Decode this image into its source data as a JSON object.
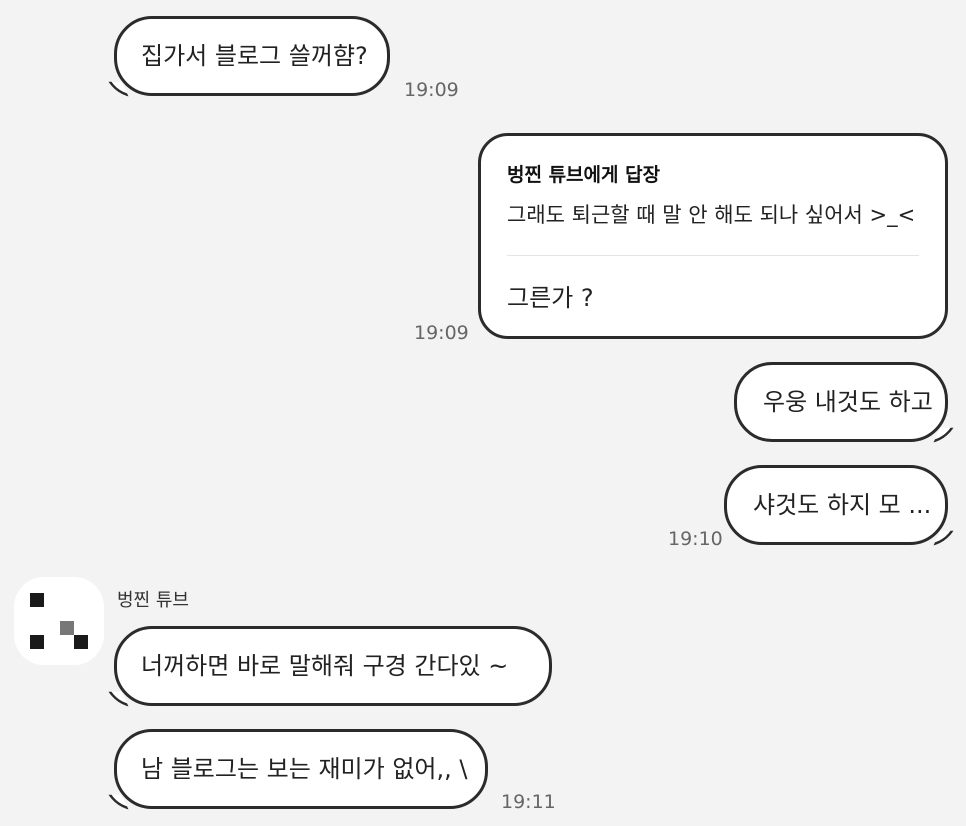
{
  "messages": {
    "m1": {
      "text": "집가서 블로그 쓸꺼햠?",
      "time": "19:09"
    },
    "m2": {
      "reply_to_name": "벙찐 튜브에게 답장",
      "reply_quote": "그래도 퇴근할 때 말 안 해도 되나 싶어서 >_<",
      "text": "그른가 ?",
      "time": "19:09"
    },
    "m3": {
      "text": "우웅 내것도 하고"
    },
    "m4": {
      "text": "샤것도 하지 모 ...",
      "time": "19:10"
    },
    "sender_name": "벙찐 튜브",
    "m5": {
      "text": "너꺼하면 바로 말해줘 구경 간다있 ~"
    },
    "m6": {
      "text": "남 블로그는 보는 재미가 없어,, \\",
      "time": "19:11"
    }
  },
  "icons": {
    "avatar": "pixel-avatar-icon"
  }
}
